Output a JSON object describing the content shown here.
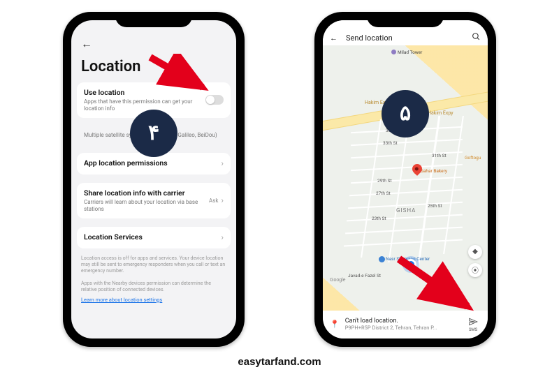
{
  "watermark": "easytarfand.com",
  "left": {
    "step_label": "۴",
    "title": "Location",
    "use_location": {
      "title": "Use location",
      "subtitle": "Apps that have this permission can get your location info"
    },
    "satellite_text": "Multiple satellite systems (GLONASS, Galileo, BeiDou)",
    "app_perms": {
      "title": "App location permissions"
    },
    "share_carrier": {
      "title": "Share location info with carrier",
      "subtitle": "Carriers will learn about your location via base stations",
      "value": "Ask"
    },
    "loc_services": {
      "title": "Location Services"
    },
    "footer1": "Location access is off for apps and services. Your device location may still be sent to emergency responders when you call or text an emergency number.",
    "footer2": "Apps with the Nearby devices permission can determine the relative position of connected devices.",
    "link": "Learn more about location settings"
  },
  "right": {
    "step_label": "۵",
    "header_title": "Send location",
    "poi_milad": "Milad Tower",
    "road_label": "Hakim Expy",
    "poi_bakery": "Sahar Bakery",
    "poi_shopping": "Nasr Shopping Center",
    "district": "GISHA",
    "poi_goftogu": "Goftogu",
    "google": "Google",
    "footer_title": "Can't load location.",
    "footer_sub": "P9PH+R5P District 2, Tehran, Tehran P...",
    "send_label": "SMS",
    "streets": [
      "35th St",
      "33th St",
      "31th St",
      "29th St",
      "27th St",
      "25th St",
      "23th St"
    ],
    "street_javad": "Javad-e Fazel St"
  }
}
